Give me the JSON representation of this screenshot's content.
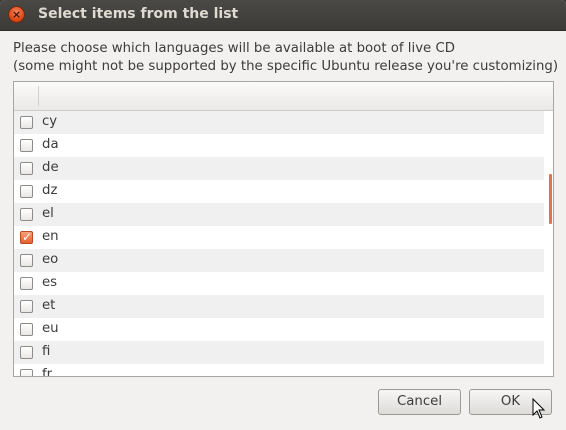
{
  "window": {
    "title": "Select items from the list",
    "close_icon": "close-icon"
  },
  "message": {
    "line1": "Please choose which languages will be available at boot of live CD",
    "line2": "(some might not be supported by the specific Ubuntu release you're customizing)"
  },
  "list": {
    "items": [
      {
        "label": "cy",
        "checked": false
      },
      {
        "label": "da",
        "checked": false
      },
      {
        "label": "de",
        "checked": false
      },
      {
        "label": "dz",
        "checked": false
      },
      {
        "label": "el",
        "checked": false
      },
      {
        "label": "en",
        "checked": true
      },
      {
        "label": "eo",
        "checked": false
      },
      {
        "label": "es",
        "checked": false
      },
      {
        "label": "et",
        "checked": false
      },
      {
        "label": "eu",
        "checked": false
      },
      {
        "label": "fi",
        "checked": false
      },
      {
        "label": "fr",
        "checked": false
      }
    ]
  },
  "buttons": {
    "cancel_label": "Cancel",
    "ok_label": "OK"
  },
  "colors": {
    "accent": "#e55e2c",
    "titlebar": "#3c3b37"
  }
}
